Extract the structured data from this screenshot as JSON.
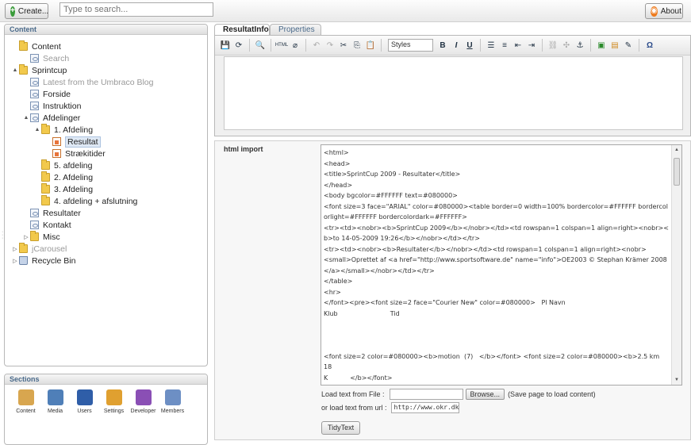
{
  "topbar": {
    "create_label": "Create...",
    "search_placeholder": "Type to search...",
    "about_label": "About"
  },
  "content_panel": {
    "header": "Content",
    "tree": [
      {
        "label": "Content",
        "icon": "folder-icon",
        "arrow": "",
        "depth": 0,
        "disabled": false
      },
      {
        "label": "Search",
        "icon": "document-icon",
        "arrow": "",
        "depth": 1,
        "disabled": true
      },
      {
        "label": "Sprintcup",
        "icon": "folder-icon",
        "arrow": "▲",
        "depth": 0,
        "disabled": false
      },
      {
        "label": "Latest from the Umbraco Blog",
        "icon": "document-icon",
        "arrow": "",
        "depth": 1,
        "disabled": true
      },
      {
        "label": "Forside",
        "icon": "document-icon",
        "arrow": "",
        "depth": 1,
        "disabled": false
      },
      {
        "label": "Instruktion",
        "icon": "document-icon",
        "arrow": "",
        "depth": 1,
        "disabled": false
      },
      {
        "label": "Afdelinger",
        "icon": "document-icon",
        "arrow": "▲",
        "depth": 1,
        "disabled": false
      },
      {
        "label": "1. Afdeling",
        "icon": "folder-icon",
        "arrow": "▲",
        "depth": 2,
        "disabled": false
      },
      {
        "label": "Resultat",
        "icon": "result-icon",
        "arrow": "",
        "depth": 3,
        "disabled": false,
        "selected": true
      },
      {
        "label": "Strækitider",
        "icon": "result-icon",
        "arrow": "",
        "depth": 3,
        "disabled": false
      },
      {
        "label": "5. afdeling",
        "icon": "folder-icon",
        "arrow": "",
        "depth": 2,
        "disabled": false
      },
      {
        "label": "2. Afdeling",
        "icon": "folder-icon",
        "arrow": "",
        "depth": 2,
        "disabled": false
      },
      {
        "label": "3. Afdeling",
        "icon": "folder-icon",
        "arrow": "",
        "depth": 2,
        "disabled": false
      },
      {
        "label": "4. afdeling + afslutning",
        "icon": "folder-icon",
        "arrow": "",
        "depth": 2,
        "disabled": false
      },
      {
        "label": "Resultater",
        "icon": "document-icon",
        "arrow": "",
        "depth": 1,
        "disabled": false
      },
      {
        "label": "Kontakt",
        "icon": "document-icon",
        "arrow": "",
        "depth": 1,
        "disabled": false
      },
      {
        "label": "Misc",
        "icon": "folder-icon",
        "arrow": "▷",
        "depth": 1,
        "disabled": false
      },
      {
        "label": "jCarousel",
        "icon": "folder-icon",
        "arrow": "▷",
        "depth": 0,
        "disabled": true
      },
      {
        "label": "Recycle Bin",
        "icon": "recycle-bin-icon",
        "arrow": "▷",
        "depth": 0,
        "disabled": false
      }
    ]
  },
  "sections_panel": {
    "header": "Sections",
    "items": [
      {
        "label": "Content",
        "icon": "content-icon",
        "color": "#d8a64f"
      },
      {
        "label": "Media",
        "icon": "media-icon",
        "color": "#4f7fb8"
      },
      {
        "label": "Users",
        "icon": "users-icon",
        "color": "#2f5ea8"
      },
      {
        "label": "Settings",
        "icon": "settings-icon",
        "color": "#e0a030"
      },
      {
        "label": "Developer",
        "icon": "developer-icon",
        "color": "#8a4fb5"
      },
      {
        "label": "Members",
        "icon": "members-icon",
        "color": "#6d8fc4"
      }
    ]
  },
  "tabs": [
    {
      "label": "ResultatInfo",
      "active": true
    },
    {
      "label": "Properties",
      "active": false
    }
  ],
  "editor": {
    "styles_label": "Styles"
  },
  "html_import": {
    "label": "html import",
    "code_lines": [
      "<html>",
      "<head>",
      "<title>SprintCup 2009 - Resultater</title>",
      "</head>",
      "<body bgcolor=#FFFFFF text=#080000>",
      "<font size=3 face=\"ARIAL\" color=#080000><table border=0 width=100% bordercolor=#FFFFFF bordercolorlight=#FFFFFF bordercolordark=#FFFFFF>",
      "<tr><td><nobr><b>SprintCup 2009</b></nobr></td><td rowspan=1 colspan=1 align=right><nobr><b>to 14-05-2009 19:26</b></nobr></td></tr>",
      "<tr><td><nobr><b>Resultater</b></nobr></td><td rowspan=1 colspan=1 align=right><nobr>",
      "<small>Oprettet af <a href=\"http://www.sportsoftware.de\" name=\"info\">OE2003 © Stephan Krämer 2008</a></small></nobr></td></tr>",
      "</table>",
      "<hr>",
      "</font><pre><font size=2 face=\"Courier New\" color=#080000>   Pl Navn",
      "Klub                          Tid",
      "",
      "",
      "",
      "<font size=2 color=#080000><b>motion  (7)   </b></font> <font size=2 color=#080000><b>2.5 km    18",
      "K           </b></font>"
    ],
    "load_file_label": "Load text from File :",
    "browse_label": "Browse...",
    "save_hint": "(Save page to load content)",
    "load_url_label": "or load text from url :",
    "url_value": "http://www.okr.dk/i",
    "tidy_label": "TidyText"
  }
}
